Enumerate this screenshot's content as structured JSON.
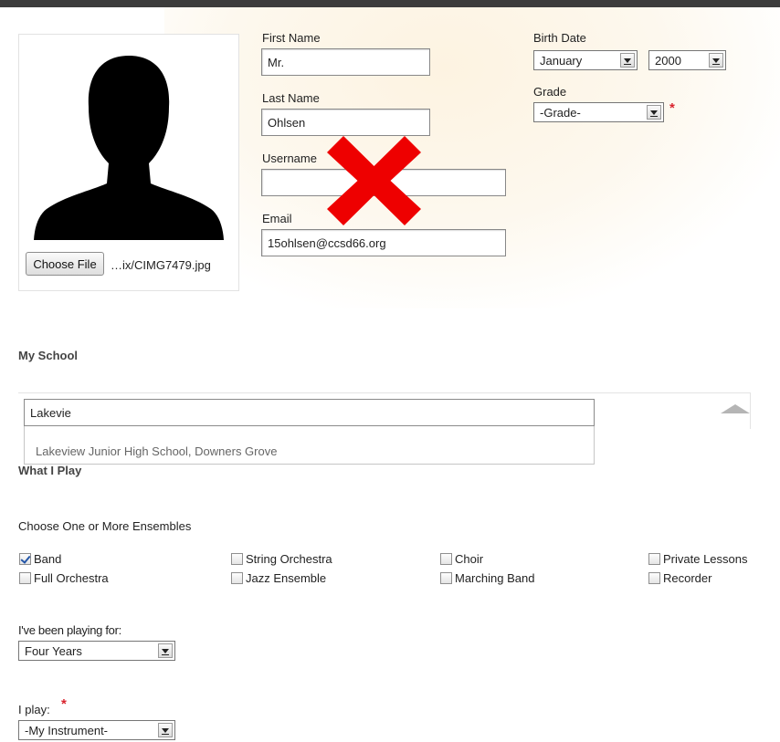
{
  "profile": {
    "photo": {
      "file_button_label": "Choose File",
      "file_name": "…ix/CIMG7479.jpg"
    },
    "first_name": {
      "label": "First Name",
      "value": "Mr."
    },
    "last_name": {
      "label": "Last Name",
      "value": "Ohlsen"
    },
    "username": {
      "label": "Username",
      "value": ""
    },
    "email": {
      "label": "Email",
      "value": "15ohlsen@ccsd66.org"
    },
    "birth_date": {
      "label": "Birth Date",
      "month": "January",
      "year": "2000"
    },
    "grade": {
      "label": "Grade",
      "value": "-Grade-",
      "required_mark": "*"
    }
  },
  "my_school": {
    "title": "My School",
    "search_value": "Lakevie",
    "suggestions": [
      "Lakeview Junior High School, Downers Grove"
    ]
  },
  "what_i_play": {
    "title": "What I Play",
    "ensembles_prompt": "Choose One or More Ensembles",
    "ensembles": [
      {
        "label": "Band",
        "checked": true
      },
      {
        "label": "String Orchestra",
        "checked": false
      },
      {
        "label": "Choir",
        "checked": false
      },
      {
        "label": "Private Lessons",
        "checked": false
      },
      {
        "label": "Full Orchestra",
        "checked": false
      },
      {
        "label": "Jazz Ensemble",
        "checked": false
      },
      {
        "label": "Marching Band",
        "checked": false
      },
      {
        "label": "Recorder",
        "checked": false
      }
    ],
    "playing_for": {
      "label": "I've been playing for:",
      "value": "Four Years"
    },
    "instrument": {
      "label": "I play:",
      "value": "-My Instrument-",
      "required_mark": "*"
    }
  },
  "colors": {
    "required": "#d9232d",
    "overlay_cross": "#ee0000",
    "header_bar": "#3c3c3c"
  }
}
